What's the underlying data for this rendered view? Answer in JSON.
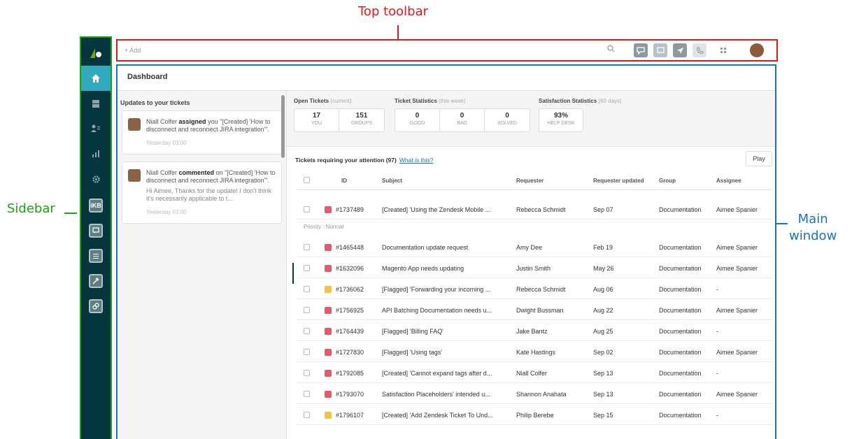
{
  "annotations": {
    "top_toolbar": "Top toolbar",
    "sidebar": "Sidebar",
    "main_window_line1": "Main",
    "main_window_line2": "window"
  },
  "sidebar": {
    "box_labels": [
      "iKB"
    ]
  },
  "toolbar": {
    "add_label": "+ Add",
    "buttons": [
      {
        "icon": "views-icon",
        "color": "#8a9aa0"
      },
      {
        "icon": "chat-icon",
        "color": "#b6c2c6"
      },
      {
        "icon": "navigation-icon",
        "color": "#8a9aa0"
      },
      {
        "icon": "phone-icon",
        "color": "#dfe5e7"
      }
    ]
  },
  "main": {
    "title": "Dashboard"
  },
  "updates": {
    "title": "Updates to your tickets",
    "items": [
      {
        "author": "Niall Colfer",
        "action": "assigned",
        "rest": "you \"[Created] 'How to disconnect and reconnect JIRA integration'\".",
        "comment": "",
        "time": "Yesterday 03:00"
      },
      {
        "author": "Niall Colfer",
        "action": "commented",
        "rest": "on \"[Created] 'How to disconnect and reconnect JIRA integration'\".",
        "comment": "Hi Aimee, Thanks for the update! I don't think it's necessarily applicable to t...",
        "time": "Yesterday 03:00"
      }
    ]
  },
  "stats": {
    "open": {
      "title": "Open Tickets",
      "qualifier": "(current)",
      "cells": [
        {
          "value": "17",
          "label": "YOU"
        },
        {
          "value": "151",
          "label": "GROUPS"
        }
      ]
    },
    "ticket": {
      "title": "Ticket Statistics",
      "qualifier": "(this week)",
      "cells": [
        {
          "value": "0",
          "label": "GOOD"
        },
        {
          "value": "0",
          "label": "BAD"
        },
        {
          "value": "0",
          "label": "SOLVED"
        }
      ]
    },
    "satisfaction": {
      "title": "Satisfaction Statistics",
      "qualifier": "(60 days)",
      "cells": [
        {
          "value": "93%",
          "label": "HELP DESK"
        }
      ]
    }
  },
  "tickets": {
    "title": "Tickets requiring your attention (97)",
    "help_link": "What is this?",
    "play_label": "Play",
    "columns": {
      "id": "ID",
      "subject": "Subject",
      "requester": "Requester",
      "updated": "Requester updated",
      "group": "Group",
      "assignee": "Assignee"
    },
    "priority_label": "Priority : Normal",
    "priority_colors": {
      "urgent": "#e35b66",
      "high": "#f0c248"
    },
    "first_row": {
      "priority": "urgent",
      "id": "#1737489",
      "subject": "[Created] 'Using the Zendesk Mobile ...",
      "requester": "Rebecca Schmidt",
      "updated": "Sep 07",
      "group": "Documentation",
      "assignee": "Aimee Spanier"
    },
    "rows": [
      {
        "priority": "urgent",
        "id": "#1465448",
        "subject": "Documentation update request",
        "requester": "Amy Dee",
        "updated": "Feb 19",
        "group": "Documentation",
        "assignee": "Aimee Spanier"
      },
      {
        "priority": "urgent",
        "id": "#1632096",
        "subject": "Magento App needs updating",
        "requester": "Justin Smith",
        "updated": "May 26",
        "group": "Documentation",
        "assignee": "Aimee Spanier"
      },
      {
        "priority": "high",
        "id": "#1736062",
        "subject": "[Flagged] 'Forwarding your incoming ...",
        "requester": "Rebecca Schmidt",
        "updated": "Aug 06",
        "group": "Documentation",
        "assignee": "-"
      },
      {
        "priority": "urgent",
        "id": "#1756925",
        "subject": "API Batching Documentation needs u...",
        "requester": "Dwight Bussman",
        "updated": "Aug 22",
        "group": "Documentation",
        "assignee": "Aimee Spanier"
      },
      {
        "priority": "urgent",
        "id": "#1764439",
        "subject": "[Flagged] 'Billing FAQ'",
        "requester": "Jake Bantz",
        "updated": "Aug 25",
        "group": "Documentation",
        "assignee": "-"
      },
      {
        "priority": "urgent",
        "id": "#1727830",
        "subject": "[Flagged] 'Using tags'",
        "requester": "Kate Hastings",
        "updated": "Sep 02",
        "group": "Documentation",
        "assignee": "Aimee Spanier"
      },
      {
        "priority": "urgent",
        "id": "#1792085",
        "subject": "[Created] 'Cannot expand tags after d...",
        "requester": "Niall Colfer",
        "updated": "Sep 13",
        "group": "Documentation",
        "assignee": "-"
      },
      {
        "priority": "urgent",
        "id": "#1793070",
        "subject": "Satisfaction Placeholders' intended u...",
        "requester": "Shannon Anahata",
        "updated": "Sep 13",
        "group": "Documentation",
        "assignee": "Aimee Spanier"
      },
      {
        "priority": "high",
        "id": "#1796107",
        "subject": "[Created] 'Add Zendesk Ticket To Und...",
        "requester": "Philip Berebe",
        "updated": "Sep 15",
        "group": "Documentation",
        "assignee": "-"
      }
    ]
  }
}
